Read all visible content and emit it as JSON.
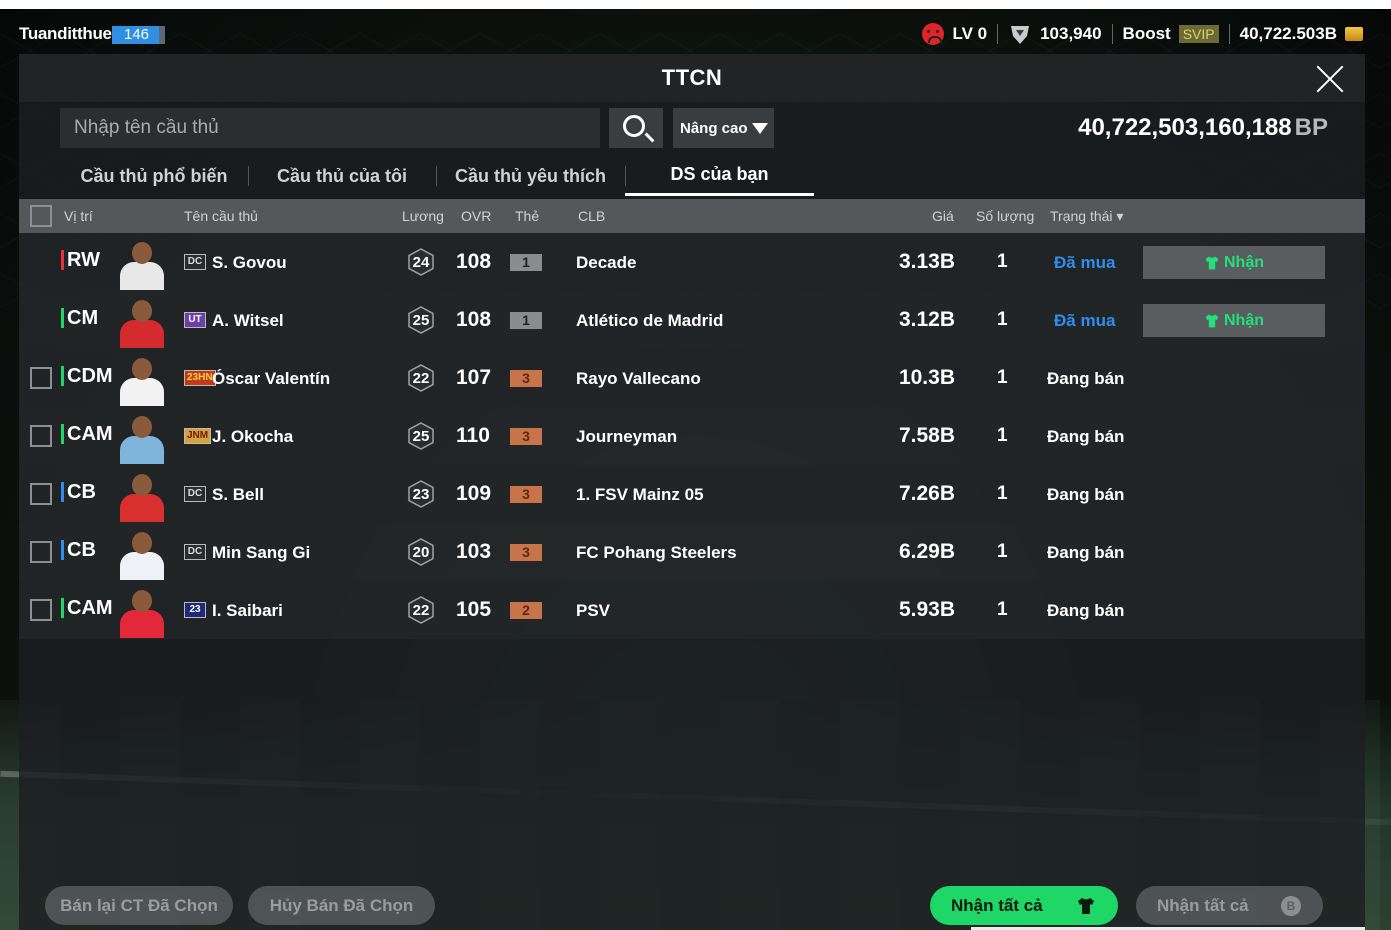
{
  "user": {
    "name": "Tuanditthue",
    "level": "146",
    "lv": "LV 0",
    "points": "103,940",
    "boost_label": "Boost",
    "svip": "SVIP",
    "bp": "40,722.503B"
  },
  "window": {
    "title": "TTCN"
  },
  "search": {
    "placeholder": "Nhập tên cầu thủ",
    "advanced_label": "Nâng cao"
  },
  "balance": {
    "value": "40,722,503,160,188",
    "unit": "BP"
  },
  "tabs": [
    {
      "label": "Cầu thủ phổ biến",
      "active": false
    },
    {
      "label": "Cầu thủ của tôi",
      "active": false
    },
    {
      "label": "Cầu thủ yêu thích",
      "active": false
    },
    {
      "label": "DS của bạn",
      "active": true
    }
  ],
  "columns": {
    "position": "Vị trí",
    "name": "Tên cầu thủ",
    "salary": "Lương",
    "ovr": "OVR",
    "grade": "Thẻ",
    "club": "CLB",
    "price": "Giá",
    "quantity": "Số lượng",
    "status": "Trạng thái"
  },
  "rows": [
    {
      "position": "RW",
      "pos_color": "#e8313a",
      "season": "DC",
      "name": "S. Govou",
      "salary": "24",
      "ovr": "108",
      "grade": "1",
      "grade_color": "#8a8d90",
      "club": "Decade",
      "price": "3.13B",
      "quantity": "1",
      "status": "Đã mua",
      "bought": true,
      "claim": "Nhận",
      "kit": "#e8e8e8"
    },
    {
      "position": "CM",
      "pos_color": "#22d46a",
      "season": "UT",
      "name": "A. Witsel",
      "salary": "25",
      "ovr": "108",
      "grade": "1",
      "grade_color": "#8a8d90",
      "club": "Atlético de Madrid",
      "price": "3.12B",
      "quantity": "1",
      "status": "Đã mua",
      "bought": true,
      "claim": "Nhận",
      "kit": "#d52b2e"
    },
    {
      "position": "CDM",
      "pos_color": "#22d46a",
      "season": "23HN",
      "name": "Óscar Valentín",
      "salary": "22",
      "ovr": "107",
      "grade": "3",
      "grade_color": "#c8744a",
      "club": "Rayo Vallecano",
      "price": "10.3B",
      "quantity": "1",
      "status": "Đang bán",
      "bought": false,
      "kit": "#f2f2f2"
    },
    {
      "position": "CAM",
      "pos_color": "#22d46a",
      "season": "JNM",
      "name": "J. Okocha",
      "salary": "25",
      "ovr": "110",
      "grade": "3",
      "grade_color": "#c8744a",
      "club": "Journeyman",
      "price": "7.58B",
      "quantity": "1",
      "status": "Đang bán",
      "bought": false,
      "kit": "#7fb4dc"
    },
    {
      "position": "CB",
      "pos_color": "#2d8ef0",
      "season": "DC",
      "name": "S. Bell",
      "salary": "23",
      "ovr": "109",
      "grade": "3",
      "grade_color": "#c8744a",
      "club": "1. FSV Mainz 05",
      "price": "7.26B",
      "quantity": "1",
      "status": "Đang bán",
      "bought": false,
      "kit": "#d8302f"
    },
    {
      "position": "CB",
      "pos_color": "#2d8ef0",
      "season": "DC",
      "name": "Min Sang Gi",
      "salary": "20",
      "ovr": "103",
      "grade": "3",
      "grade_color": "#c8744a",
      "club": "FC Pohang Steelers",
      "price": "6.29B",
      "quantity": "1",
      "status": "Đang bán",
      "bought": false,
      "kit": "#eef2f6"
    },
    {
      "position": "CAM",
      "pos_color": "#22d46a",
      "season": "23",
      "name": "I. Saibari",
      "salary": "22",
      "ovr": "105",
      "grade": "2",
      "grade_color": "#c8744a",
      "club": "PSV",
      "price": "5.93B",
      "quantity": "1",
      "status": "Đang bán",
      "bought": false,
      "kit": "#e3283a"
    }
  ],
  "footer": {
    "resell_selected": "Bán lại CT Đã Chọn",
    "cancel_selected": "Hủy Bán Đã Chọn",
    "claim_all_green": "Nhận tất cả",
    "claim_all_grey": "Nhận tất cả"
  },
  "colors": {
    "accent_green": "#1ed766",
    "bought_blue": "#2d8ef0"
  }
}
